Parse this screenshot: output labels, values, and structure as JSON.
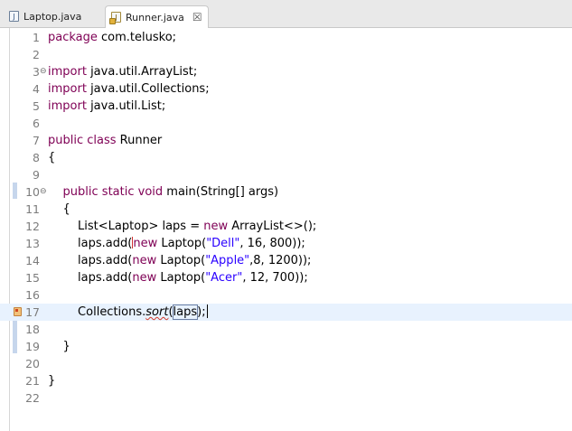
{
  "tabs": [
    {
      "label": "Laptop.java",
      "icon": "java-file-icon",
      "active": false
    },
    {
      "label": "Runner.java",
      "icon": "java-file-warning-icon",
      "active": true,
      "close": "☒"
    }
  ],
  "lines": [
    {
      "n": "1",
      "seg": [
        [
          "package",
          "kw"
        ],
        [
          " com.telusko;",
          ""
        ]
      ]
    },
    {
      "n": "2",
      "seg": []
    },
    {
      "n": "3",
      "fold": "⊖",
      "seg": [
        [
          "import",
          "kw"
        ],
        [
          " java.util.ArrayList;",
          ""
        ]
      ]
    },
    {
      "n": "4",
      "seg": [
        [
          "import",
          "kw"
        ],
        [
          " java.util.Collections;",
          ""
        ]
      ]
    },
    {
      "n": "5",
      "seg": [
        [
          "import",
          "kw"
        ],
        [
          " java.util.List;",
          ""
        ]
      ]
    },
    {
      "n": "6",
      "seg": []
    },
    {
      "n": "7",
      "seg": [
        [
          "public",
          "kw"
        ],
        [
          " ",
          ""
        ],
        [
          "class",
          "kw"
        ],
        [
          " Runner",
          ""
        ]
      ]
    },
    {
      "n": "8",
      "seg": [
        [
          "{",
          ""
        ]
      ]
    },
    {
      "n": "9",
      "seg": []
    },
    {
      "n": "10",
      "fold": "⊖",
      "seg": [
        [
          "    ",
          ""
        ],
        [
          "public",
          "kw"
        ],
        [
          " ",
          ""
        ],
        [
          "static",
          "kw"
        ],
        [
          " ",
          ""
        ],
        [
          "void",
          "kw"
        ],
        [
          " main(String[] args)",
          ""
        ]
      ]
    },
    {
      "n": "11",
      "seg": [
        [
          "    {",
          ""
        ]
      ]
    },
    {
      "n": "12",
      "seg": [
        [
          "        List<Laptop> laps = ",
          ""
        ],
        [
          "new",
          "kw"
        ],
        [
          " ArrayList<>();",
          ""
        ]
      ]
    },
    {
      "n": "13",
      "seg": [
        [
          "        laps.add(",
          ""
        ],
        [
          "CARET_RED",
          ""
        ],
        [
          "new",
          "kw"
        ],
        [
          " Laptop(",
          ""
        ],
        [
          "\"Dell\"",
          "str"
        ],
        [
          ", 16, 800));",
          ""
        ]
      ]
    },
    {
      "n": "14",
      "seg": [
        [
          "        laps.add(",
          ""
        ],
        [
          "new",
          "kw"
        ],
        [
          " Laptop(",
          ""
        ],
        [
          "\"Apple\"",
          "str"
        ],
        [
          ",8, 1200));",
          ""
        ]
      ]
    },
    {
      "n": "15",
      "seg": [
        [
          "        laps.add(",
          ""
        ],
        [
          "new",
          "kw"
        ],
        [
          " Laptop(",
          ""
        ],
        [
          "\"Acer\"",
          "str"
        ],
        [
          ", 12, 700));",
          ""
        ]
      ]
    },
    {
      "n": "16",
      "seg": []
    },
    {
      "n": "17",
      "marker": true,
      "current": true,
      "seg": [
        [
          "        Collections.",
          ""
        ],
        [
          "sort",
          "err"
        ],
        [
          "(",
          ""
        ],
        [
          "laps",
          "box"
        ],
        [
          ");",
          ""
        ],
        [
          "CARET",
          ""
        ]
      ]
    },
    {
      "n": "18",
      "seg": []
    },
    {
      "n": "19",
      "seg": [
        [
          "    }",
          ""
        ]
      ]
    },
    {
      "n": "20",
      "seg": []
    },
    {
      "n": "21",
      "seg": [
        [
          "}",
          ""
        ]
      ]
    },
    {
      "n": "22",
      "seg": []
    }
  ]
}
